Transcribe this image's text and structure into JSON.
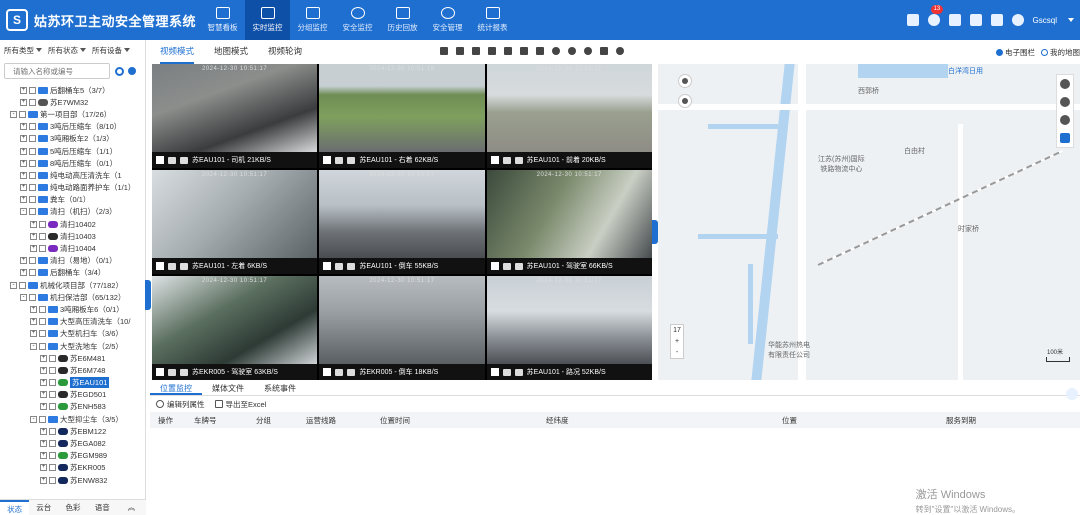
{
  "header": {
    "logo_text": "S",
    "app_title": "姑苏环卫主动安全管理系统",
    "nav": [
      {
        "label": "智慧看板",
        "icon": "dashboard-icon"
      },
      {
        "label": "实时监控",
        "icon": "map-pin-icon",
        "active": true
      },
      {
        "label": "分组监控",
        "icon": "group-icon"
      },
      {
        "label": "安全监控",
        "icon": "shield-icon"
      },
      {
        "label": "历史回放",
        "icon": "history-icon"
      },
      {
        "label": "安全管理",
        "icon": "shield-check-icon"
      },
      {
        "label": "统计报表",
        "icon": "chart-icon"
      }
    ],
    "notification_count": "13",
    "user_name": "Gscsql"
  },
  "left": {
    "filters": [
      "所有类型",
      "所有状态",
      "所有设备"
    ],
    "search_placeholder": "请输入名称或编号",
    "tree": [
      {
        "indent": 2,
        "exp": "+",
        "icon": "ticon",
        "label": "后翻桶车5（3/7）"
      },
      {
        "indent": 2,
        "exp": "+",
        "icon": "ticon car",
        "label": "苏E7WM32"
      },
      {
        "indent": 1,
        "exp": "-",
        "icon": "ticon",
        "label": "第一项目部（17/26）"
      },
      {
        "indent": 2,
        "exp": "+",
        "icon": "ticon",
        "label": "3吨后压缩车（8/10）"
      },
      {
        "indent": 2,
        "exp": "+",
        "icon": "ticon",
        "label": "3吨厢板车2（1/3）"
      },
      {
        "indent": 2,
        "exp": "+",
        "icon": "ticon",
        "label": "5吨后压缩车（1/1）"
      },
      {
        "indent": 2,
        "exp": "+",
        "icon": "ticon",
        "label": "8吨后压缩车（0/1）"
      },
      {
        "indent": 2,
        "exp": "+",
        "icon": "ticon",
        "label": "纯电动高压清洗车（1"
      },
      {
        "indent": 2,
        "exp": "+",
        "icon": "ticon",
        "label": "纯电动路面养护车（1/1）"
      },
      {
        "indent": 2,
        "exp": "+",
        "icon": "ticon",
        "label": "粪车（0/1）"
      },
      {
        "indent": 2,
        "exp": "-",
        "icon": "ticon",
        "label": "清扫（机扫）（2/3）"
      },
      {
        "indent": 3,
        "exp": "+",
        "icon": "ticon purple",
        "label": "清扫10402"
      },
      {
        "indent": 3,
        "exp": "+",
        "icon": "ticon dark",
        "label": "清扫10403"
      },
      {
        "indent": 3,
        "exp": "+",
        "icon": "ticon purple",
        "label": "清扫10404"
      },
      {
        "indent": 2,
        "exp": "+",
        "icon": "ticon",
        "label": "清扫（易地）（0/1）"
      },
      {
        "indent": 2,
        "exp": "+",
        "icon": "ticon",
        "label": "后翻桶车（3/4）"
      },
      {
        "indent": 1,
        "exp": "-",
        "icon": "ticon",
        "label": "机械化项目部（77/182）"
      },
      {
        "indent": 2,
        "exp": "-",
        "icon": "ticon",
        "label": "机扫保洁部（65/132）"
      },
      {
        "indent": 3,
        "exp": "+",
        "icon": "ticon",
        "label": "3吨厢板车6（0/1）"
      },
      {
        "indent": 3,
        "exp": "+",
        "icon": "ticon",
        "label": "大型高压清洗车（10/"
      },
      {
        "indent": 3,
        "exp": "+",
        "icon": "ticon",
        "label": "大型机扫车（3/6）"
      },
      {
        "indent": 3,
        "exp": "-",
        "icon": "ticon",
        "label": "大型洗地车（2/5）"
      },
      {
        "indent": 4,
        "exp": "+",
        "icon": "ticon dark",
        "label": "苏E6M481"
      },
      {
        "indent": 4,
        "exp": "+",
        "icon": "ticon dark",
        "label": "苏E6M748"
      },
      {
        "indent": 4,
        "exp": "+",
        "icon": "ticon green",
        "label": "苏EAU101",
        "selected": true
      },
      {
        "indent": 4,
        "exp": "+",
        "icon": "ticon dark",
        "label": "苏EGD501"
      },
      {
        "indent": 4,
        "exp": "+",
        "icon": "ticon green",
        "label": "苏ENH583"
      },
      {
        "indent": 3,
        "exp": "-",
        "icon": "ticon",
        "label": "大型抑尘车（3/5）"
      },
      {
        "indent": 4,
        "exp": "+",
        "icon": "ticon navy",
        "label": "苏EBM122"
      },
      {
        "indent": 4,
        "exp": "+",
        "icon": "ticon navy",
        "label": "苏EGA082"
      },
      {
        "indent": 4,
        "exp": "+",
        "icon": "ticon green",
        "label": "苏EGM989"
      },
      {
        "indent": 4,
        "exp": "+",
        "icon": "ticon navy",
        "label": "苏EKR005"
      },
      {
        "indent": 4,
        "exp": "+",
        "icon": "ticon navy",
        "label": "苏ENW832"
      }
    ],
    "bottom_tabs": [
      "状态",
      "云台",
      "色彩",
      "语音",
      "︽"
    ]
  },
  "mode_bar": {
    "tabs": [
      "视频模式",
      "地图模式",
      "视频轮询"
    ],
    "right": [
      {
        "label": "电子围栏"
      },
      {
        "label": "我的地图"
      }
    ]
  },
  "videos": [
    {
      "time": "2024-12-30 10:51:17",
      "caption": "苏EAU101 - 司机 21KB/S"
    },
    {
      "time": "2024-12-30 10:51:19",
      "caption": "苏EAU101 - 右着 62KB/S"
    },
    {
      "time": "2024-12-30 10:51:17",
      "caption": "苏EAU101 - 前着 20KB/S"
    },
    {
      "time": "2024-12-30 10:51:17",
      "caption": "苏EAU101 - 左着 6KB/S"
    },
    {
      "time": "2024-12-30 10:51:17",
      "caption": "苏EAU101 - 倒车 55KB/S"
    },
    {
      "time": "2024-12-30 10:51:17",
      "caption": "苏EAU101 - 驾驶室 66KB/S"
    },
    {
      "time": "2024-12-30 10:51:17",
      "caption": "苏EKR005 - 驾驶室 63KB/S"
    },
    {
      "time": "2024-12-30 10:51:17",
      "caption": "苏EKR005 - 倒车 18KB/S"
    },
    {
      "time": "2024-12-30 10:51:17",
      "caption": "苏EAU101 - 路况 52KB/S"
    }
  ],
  "map": {
    "labels": {
      "a": "白洋湾日用",
      "b": "西郭桥",
      "c": "江苏(苏州)国际\n铁路物流中心",
      "d": "白由村",
      "e": "时家桥",
      "f": "华能苏州热电\n有限责任公司"
    },
    "zoom_level": "17",
    "zoom_in": "+",
    "zoom_out": "-",
    "scale": "100米"
  },
  "bottom": {
    "tabs": [
      "位置监控",
      "媒体文件",
      "系统事件"
    ],
    "actions": [
      "编辑列属性",
      "导出至Excel"
    ],
    "columns": [
      "操作",
      "车牌号",
      "分组",
      "运营线路",
      "位置时间",
      "经纬度",
      "位置",
      "服务到期"
    ]
  },
  "watermark": {
    "line1": "激活 Windows",
    "line2": "转到\"设置\"以激活 Windows。"
  }
}
